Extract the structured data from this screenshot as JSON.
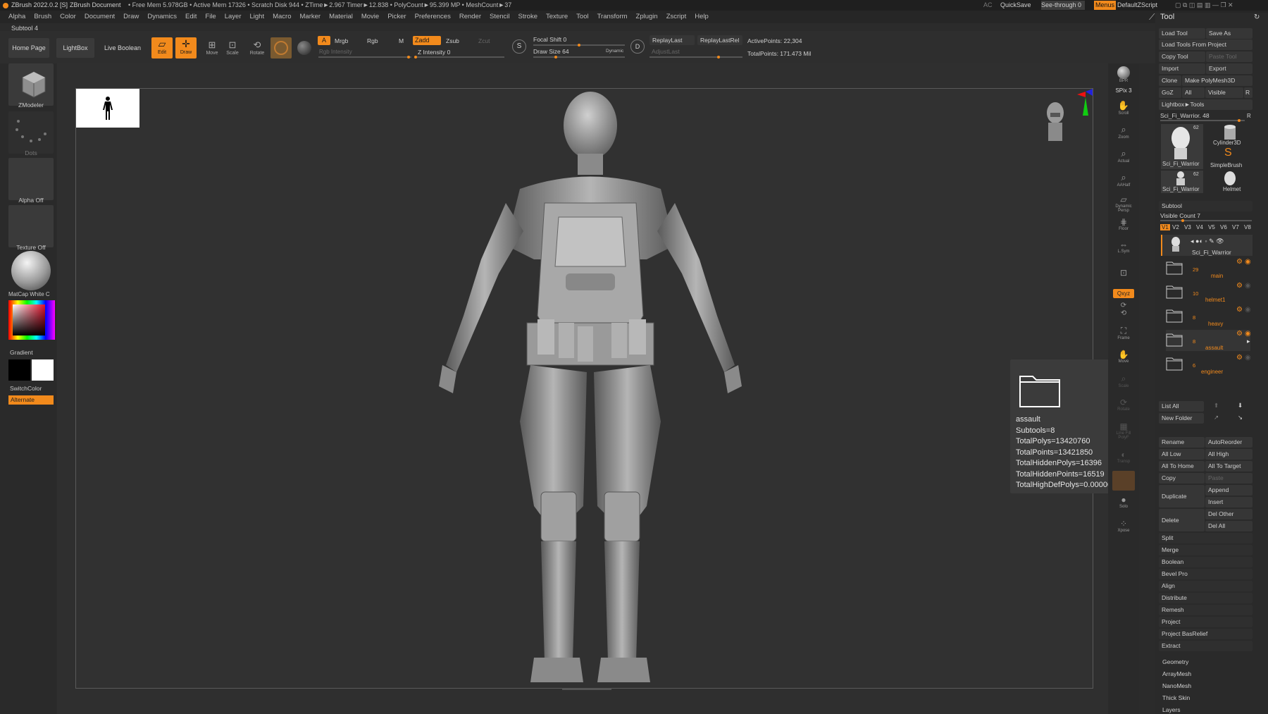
{
  "titlebar": {
    "app": "ZBrush 2022.0.2 [S]",
    "doc": "ZBrush Document",
    "stats": "• Free Mem 5.978GB • Active Mem 17326 • Scratch Disk 944 • ZTime►2.967 Timer►12.838 • PolyCount►95.399 MP • MeshCount►37",
    "ac": "AC",
    "quicksave": "QuickSave",
    "seethrough": "See-through  0",
    "menus": "Menus",
    "zscript": "DefaultZScript"
  },
  "menus": [
    "Alpha",
    "Brush",
    "Color",
    "Document",
    "Draw",
    "Dynamics",
    "Edit",
    "File",
    "Layer",
    "Light",
    "Macro",
    "Marker",
    "Material",
    "Movie",
    "Picker",
    "Preferences",
    "Render",
    "Stencil",
    "Stroke",
    "Texture",
    "Tool",
    "Transform",
    "Zplugin",
    "Zscript",
    "Help"
  ],
  "subtool_title": "Subtool 4",
  "topbar": {
    "home": "Home Page",
    "lightbox": "LightBox",
    "liveboolean": "Live Boolean",
    "edit": "Edit",
    "draw": "Draw",
    "move": "Move",
    "scale": "Scale",
    "rotate": "Rotate",
    "a": "A",
    "mrgb": "Mrgb",
    "rgb": "Rgb",
    "m": "M",
    "zadd": "Zadd",
    "zsub": "Zsub",
    "zcut": "Zcut",
    "rgb_intensity": "Rgb Intensity",
    "z_intensity": "Z Intensity 0",
    "focal_shift": "Focal Shift 0",
    "draw_size": "Draw Size 64",
    "dynamic": "Dynamic",
    "replaylast": "ReplayLast",
    "replaylastrel": "ReplayLastRel",
    "adjustlast": "AdjustLast",
    "activepoints": "ActivePoints: 22,304",
    "totalpoints": "TotalPoints: 171.473 Mil"
  },
  "left": {
    "zmodeler": "ZModeler",
    "dots": "Dots",
    "alpha": "Alpha Off",
    "texture": "Texture Off",
    "matcap": "MatCap White C",
    "gradient": "Gradient",
    "switchcolor": "SwitchColor",
    "alternate": "Alternate"
  },
  "shelf": [
    "BPR",
    "SPix 3",
    "Scroll",
    "Zoom",
    "Actual",
    "AAHalf",
    "Dynamic Persp",
    "Floor",
    "L.Sym",
    "",
    "Qxyz",
    "",
    "",
    "Frame",
    "Move",
    "Scale",
    "Rotate",
    "Line Fill PolyF",
    "",
    "Transp",
    "",
    "Solo",
    "Xpose"
  ],
  "tooltip": {
    "name": "assault",
    "lines": [
      "Subtools=8",
      "TotalPolys=13420760",
      "TotalPoints=13421850",
      "TotalHiddenPolys=16396",
      "TotalHiddenPoints=16519",
      "TotalHighDefPolys=0.0000000 Mil"
    ]
  },
  "tool": {
    "title": "Tool",
    "load_tool": "Load Tool",
    "save_as": "Save As",
    "load_from_project": "Load Tools From Project",
    "copy_tool": "Copy Tool",
    "paste_tool": "Paste Tool",
    "import": "Import",
    "export": "Export",
    "clone": "Clone",
    "make_polymesh": "Make PolyMesh3D",
    "goz": "GoZ",
    "all": "All",
    "visible": "Visible",
    "r": "R",
    "lightbox_tools": "Lightbox►Tools",
    "current_tool": "Sci_Fi_Warrior. 48",
    "tools": [
      {
        "name": "Sci_Fi_Warrior",
        "count": "62"
      },
      {
        "name": "Cylinder3D",
        "count": ""
      },
      {
        "name": "SimpleBrush",
        "count": ""
      },
      {
        "name": "Sci_Fi_Warrior",
        "count": "62"
      },
      {
        "name": "Helmet",
        "count": ""
      }
    ],
    "subtool_header": "Subtool",
    "visible_count": "Visible Count 7",
    "vtabs": [
      "V1",
      "V2",
      "V3",
      "V4",
      "V5",
      "V6",
      "V7",
      "V8"
    ],
    "top_subtool": "Sci_Fi_Warrior",
    "folders": [
      {
        "count": "29",
        "name": "main"
      },
      {
        "count": "10",
        "name": "helmet1"
      },
      {
        "count": "8",
        "name": "heavy"
      },
      {
        "count": "8",
        "name": "assault"
      },
      {
        "count": "6",
        "name": "engineer"
      }
    ],
    "list_all": "List All",
    "new_folder": "New Folder",
    "rename": "Rename",
    "autoreorder": "AutoReorder",
    "all_low": "All Low",
    "all_high": "All High",
    "all_to_home": "All To Home",
    "all_to_target": "All To Target",
    "copy": "Copy",
    "paste": "Paste",
    "duplicate": "Duplicate",
    "append": "Append",
    "insert": "Insert",
    "delete": "Delete",
    "del_other": "Del Other",
    "del_all": "Del All",
    "actions": [
      "Split",
      "Merge",
      "Boolean",
      "Bevel Pro",
      "Align",
      "Distribute",
      "Remesh",
      "Project",
      "Project BasRelief",
      "Extract"
    ],
    "sections": [
      "Geometry",
      "ArrayMesh",
      "NanoMesh",
      "Thick Skin",
      "Layers"
    ]
  },
  "colors": {
    "accent": "#f28a1c",
    "panel": "#2a2a2a"
  }
}
